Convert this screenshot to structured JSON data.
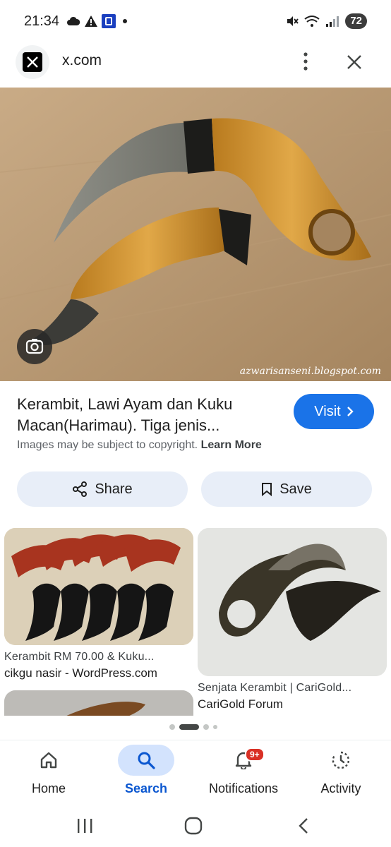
{
  "status_bar": {
    "time": "21:34",
    "battery": "72",
    "left_icons": [
      "cloud-icon",
      "warning-icon",
      "app-notification-icon",
      "dot-icon"
    ],
    "right_icons": [
      "mute-icon",
      "wifi-icon",
      "signal-icon"
    ]
  },
  "top_bar": {
    "site_title": "x.com",
    "logo_icon": "x-logo-icon"
  },
  "main_image": {
    "watermark": "azwarisanseni.blogspot.com"
  },
  "result": {
    "title": "Kerambit, Lawi Ayam dan Kuku Macan(Harimau). Tiga jenis...",
    "visit_label": "Visit",
    "copyright_text": "Images may be subject to copyright.",
    "learn_more": "Learn More"
  },
  "actions": {
    "share_label": "Share",
    "save_label": "Save"
  },
  "related": [
    {
      "title": "Kerambit RM 70.00 & Kuku...",
      "source": "cikgu nasir - WordPress.com"
    },
    {
      "title": "Senjata Kerambit | CariGold...",
      "source": "CariGold Forum"
    }
  ],
  "bottom_nav": {
    "items": [
      {
        "label": "Home",
        "icon": "home-icon",
        "active": false
      },
      {
        "label": "Search",
        "icon": "search-icon",
        "active": true
      },
      {
        "label": "Notifications",
        "icon": "bell-icon",
        "active": false,
        "badge": "9+"
      },
      {
        "label": "Activity",
        "icon": "activity-icon",
        "active": false
      }
    ]
  },
  "colors": {
    "accent": "#1a73e8",
    "active_nav": "#0b57d0",
    "badge": "#d93025"
  }
}
